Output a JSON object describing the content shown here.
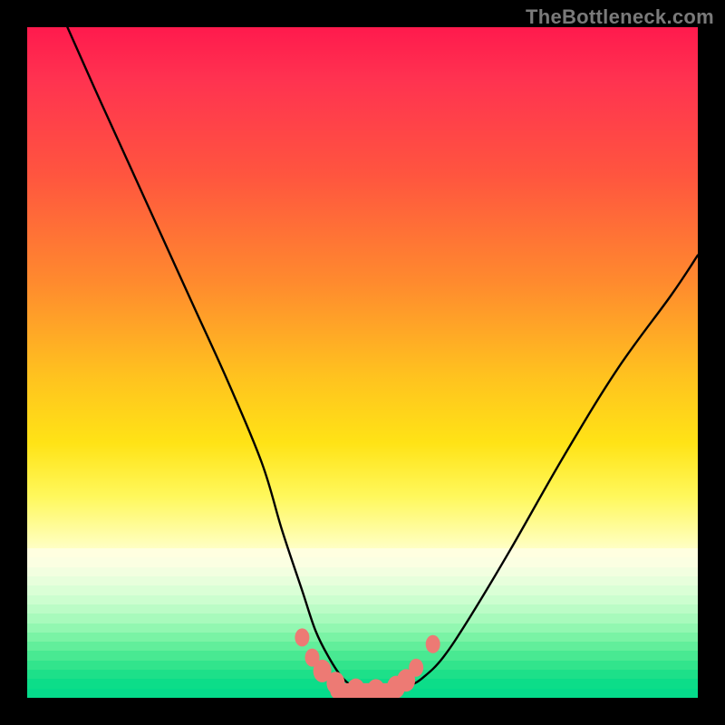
{
  "watermark": "TheBottleneck.com",
  "chart_data": {
    "type": "line",
    "title": "",
    "xlabel": "",
    "ylabel": "",
    "xlim": [
      0,
      100
    ],
    "ylim": [
      0,
      100
    ],
    "series": [
      {
        "name": "bottleneck-curve",
        "x": [
          6,
          10,
          15,
          20,
          25,
          30,
          35,
          38,
          41,
          43,
          45,
          47,
          49,
          51,
          53,
          55,
          57,
          59,
          62,
          66,
          72,
          80,
          88,
          96,
          100
        ],
        "y": [
          100,
          91,
          80,
          69,
          58,
          47,
          35,
          25,
          16,
          10,
          6,
          3,
          1.5,
          1,
          1,
          1.2,
          1.8,
          3,
          6,
          12,
          22,
          36,
          49,
          60,
          66
        ]
      }
    ],
    "annotations": {
      "minima_markers_x": [
        41,
        42.5,
        44,
        46,
        49,
        52,
        55,
        56.5,
        58,
        60.5
      ],
      "minima_markers_y": [
        9,
        6,
        4,
        2.2,
        1.2,
        1.1,
        1.6,
        2.6,
        4.5,
        8
      ]
    },
    "background_gradient": {
      "top_color": "#ff1a4d",
      "bottom_color": "#05dc8c",
      "description": "vertical red-to-yellow-to-green gradient indicating bottleneck severity; green = balanced"
    }
  },
  "stripe_colors": [
    "#ffffe0",
    "#fbffe2",
    "#f2ffe0",
    "#e7ffdc",
    "#daffd6",
    "#ccfecf",
    "#bbfcc6",
    "#a8fabc",
    "#92f7b1",
    "#7af3a5",
    "#62ee9b",
    "#49e992",
    "#32e48c",
    "#1de089",
    "#0cdd89",
    "#05db8b"
  ]
}
